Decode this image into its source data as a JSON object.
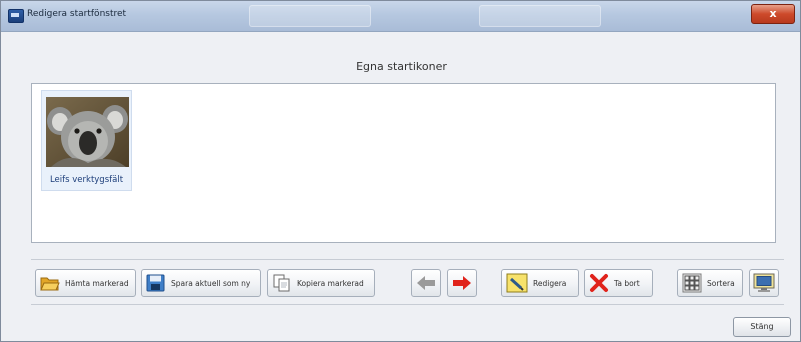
{
  "window": {
    "title": "Redigera startfönstret",
    "close_glyph": "x"
  },
  "section": {
    "title": "Egna startikoner"
  },
  "icons": [
    {
      "label": "Leifs verktygsfält",
      "icon": "koala-thumbnail"
    }
  ],
  "toolbar": {
    "fetch_label": "Hämta markerad",
    "save_label": "Spara aktuell som ny",
    "copy_label": "Kopiera markerad",
    "edit_label": "Redigera",
    "delete_label": "Ta bort",
    "sort_label": "Sortera"
  },
  "footer": {
    "close_label": "Stäng"
  },
  "colors": {
    "arrow_left": "#9a9a9a",
    "arrow_right": "#e0231b",
    "delete_x": "#e0231b"
  }
}
